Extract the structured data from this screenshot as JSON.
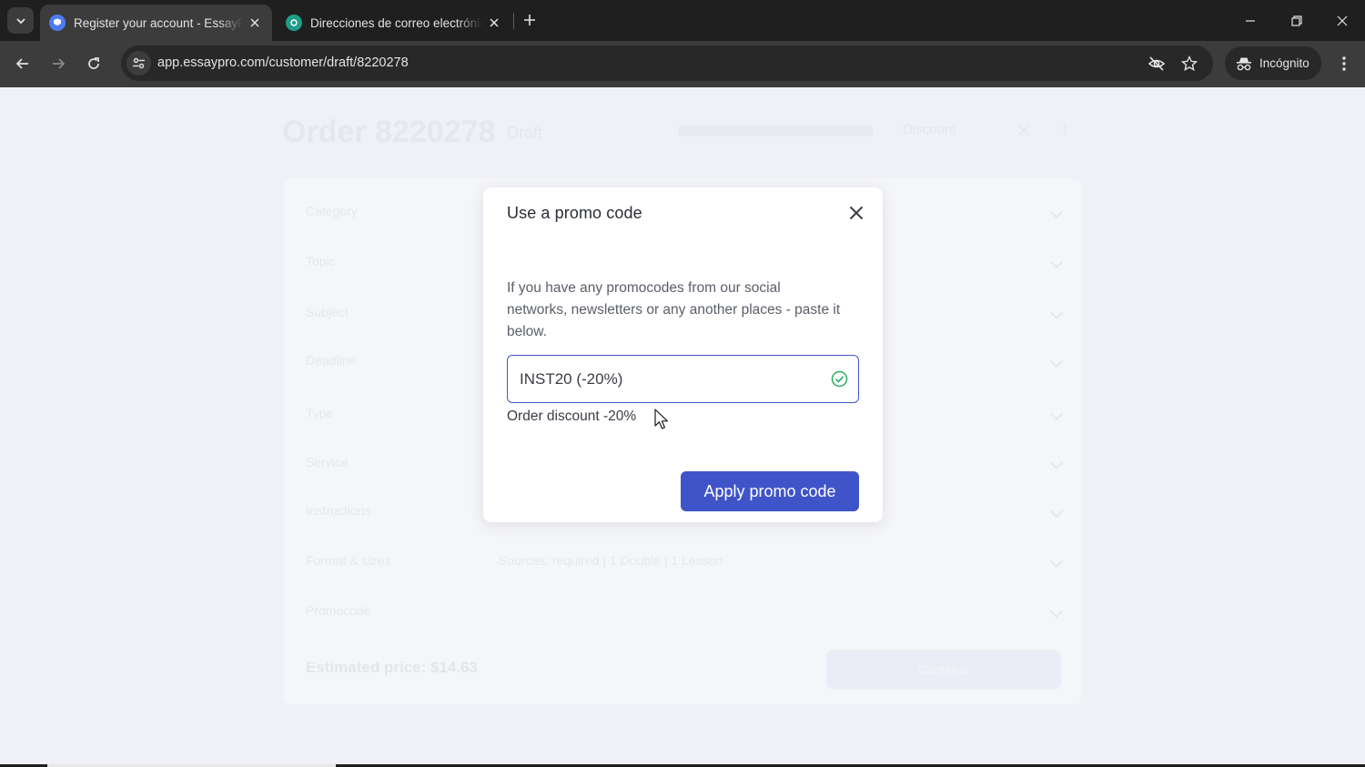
{
  "browser": {
    "tabs": [
      {
        "title": "Register your account - EssayPro",
        "active": true
      },
      {
        "title": "Direcciones de correo electrónico",
        "active": false
      }
    ],
    "url": "app.essaypro.com/customer/draft/8220278",
    "incognito_label": "Incógnito",
    "colors": {
      "tabbar": "#1f1f1f",
      "toolbar": "#3c3c3c",
      "omnibox": "#282828"
    }
  },
  "order_page": {
    "title": "Order 8220278",
    "status": "Draft",
    "header_button": "Discount",
    "rows": [
      {
        "label": "Category",
        "value": ""
      },
      {
        "label": "Topic",
        "value": ""
      },
      {
        "label": "Subject",
        "value": ""
      },
      {
        "label": "Deadline",
        "value": ""
      },
      {
        "label": "Type",
        "value": ""
      },
      {
        "label": "Service",
        "value": ""
      },
      {
        "label": "Instructions",
        "value": ""
      },
      {
        "label": "Format & sizes",
        "value": "Sources: required | 1 Double | 1 Lesson"
      },
      {
        "label": "Promocode",
        "value": ""
      }
    ],
    "estimated_price": "Estimated price: $14.63",
    "continue_label": "Continue"
  },
  "modal": {
    "title": "Use a promo code",
    "description": "If you have any promocodes from our social networks, newsletters or any another places - paste it below.",
    "input_value": "INST20 (-20%)",
    "discount_note": "Order discount -20%",
    "apply_label": "Apply promo code",
    "colors": {
      "accent": "#4054c9",
      "valid": "#27ae60"
    }
  }
}
